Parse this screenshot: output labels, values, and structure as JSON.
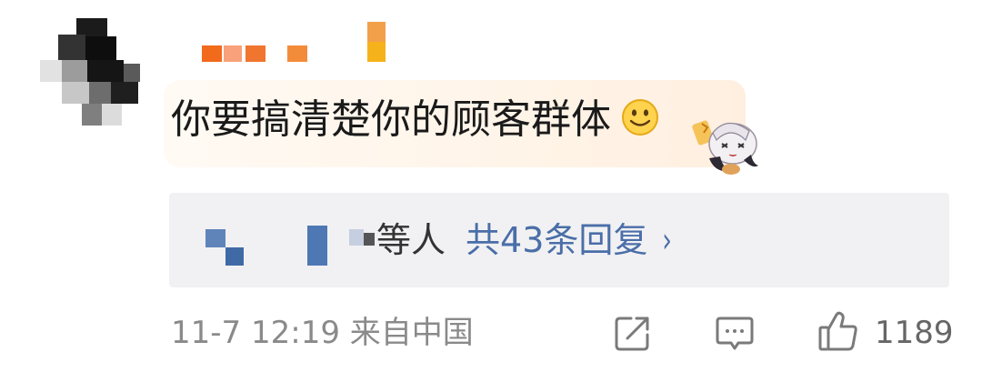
{
  "comment": {
    "text": "你要搞清楚你的顾客群体",
    "emoji": "smile-emoji"
  },
  "replies": {
    "suffix": "等人",
    "count_label": "共43条回复",
    "arrow": "›"
  },
  "footer": {
    "timestamp": "11-7 12:19 来自中国",
    "like_count": "1189"
  },
  "colors": {
    "link_blue": "#4a6ea8",
    "meta_gray": "#8a8a8a",
    "reply_bg": "#f1f1f3"
  }
}
